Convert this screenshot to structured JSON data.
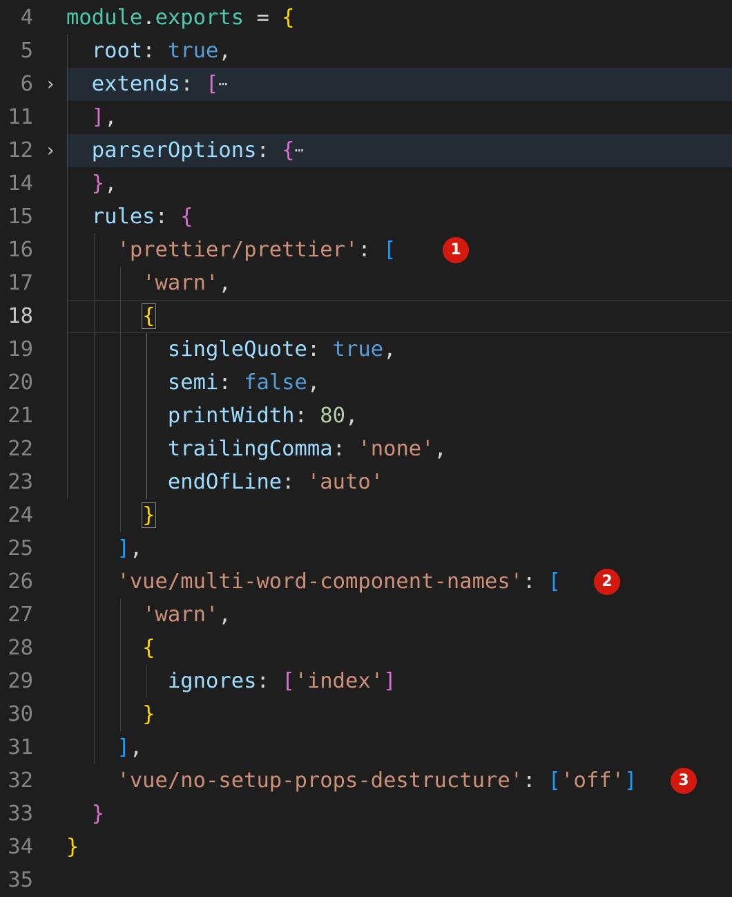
{
  "editor": {
    "language": "javascript",
    "theme": {
      "background": "#1e1e1e",
      "line_highlight": "#232b35",
      "badge_color": "#d4190f"
    },
    "active_line": "18",
    "lines": [
      {
        "num": "4",
        "tokens": [
          {
            "t": "module",
            "c": "pk"
          },
          {
            "t": ".",
            "c": "p"
          },
          {
            "t": "exports",
            "c": "pk"
          },
          {
            "t": " = ",
            "c": "p"
          },
          {
            "t": "{",
            "c": "b1"
          }
        ]
      },
      {
        "num": "5",
        "tokens": [
          {
            "t": "  ",
            "c": "p"
          },
          {
            "t": "root",
            "c": "prop"
          },
          {
            "t": ": ",
            "c": "p"
          },
          {
            "t": "true",
            "c": "kw"
          },
          {
            "t": ",",
            "c": "p"
          }
        ]
      },
      {
        "num": "6",
        "folded": true,
        "highlight": true,
        "tokens": [
          {
            "t": "  ",
            "c": "p"
          },
          {
            "t": "extends",
            "c": "prop"
          },
          {
            "t": ": ",
            "c": "p"
          },
          {
            "t": "[",
            "c": "b2"
          },
          {
            "t": "⋯",
            "c": "ell"
          }
        ]
      },
      {
        "num": "11",
        "tokens": [
          {
            "t": "  ",
            "c": "p"
          },
          {
            "t": "]",
            "c": "b2"
          },
          {
            "t": ",",
            "c": "p"
          }
        ]
      },
      {
        "num": "12",
        "folded": true,
        "highlight": true,
        "tokens": [
          {
            "t": "  ",
            "c": "p"
          },
          {
            "t": "parserOptions",
            "c": "prop"
          },
          {
            "t": ": ",
            "c": "p"
          },
          {
            "t": "{",
            "c": "b2"
          },
          {
            "t": "⋯",
            "c": "ell"
          }
        ]
      },
      {
        "num": "14",
        "tokens": [
          {
            "t": "  ",
            "c": "p"
          },
          {
            "t": "}",
            "c": "b2"
          },
          {
            "t": ",",
            "c": "p"
          }
        ]
      },
      {
        "num": "15",
        "tokens": [
          {
            "t": "  ",
            "c": "p"
          },
          {
            "t": "rules",
            "c": "prop"
          },
          {
            "t": ": ",
            "c": "p"
          },
          {
            "t": "{",
            "c": "b2"
          }
        ]
      },
      {
        "num": "16",
        "badge": "1",
        "tokens": [
          {
            "t": "    ",
            "c": "p"
          },
          {
            "t": "'prettier/prettier'",
            "c": "str"
          },
          {
            "t": ": ",
            "c": "p"
          },
          {
            "t": "[",
            "c": "b3"
          }
        ]
      },
      {
        "num": "17",
        "tokens": [
          {
            "t": "      ",
            "c": "p"
          },
          {
            "t": "'warn'",
            "c": "str"
          },
          {
            "t": ",",
            "c": "p"
          }
        ]
      },
      {
        "num": "18",
        "cursor": true,
        "tokens": [
          {
            "t": "      ",
            "c": "p"
          },
          {
            "t": "{",
            "c": "b1 bracket-box"
          }
        ]
      },
      {
        "num": "19",
        "tokens": [
          {
            "t": "        ",
            "c": "p"
          },
          {
            "t": "singleQuote",
            "c": "prop"
          },
          {
            "t": ": ",
            "c": "p"
          },
          {
            "t": "true",
            "c": "kw"
          },
          {
            "t": ",",
            "c": "p"
          }
        ]
      },
      {
        "num": "20",
        "tokens": [
          {
            "t": "        ",
            "c": "p"
          },
          {
            "t": "semi",
            "c": "prop"
          },
          {
            "t": ": ",
            "c": "p"
          },
          {
            "t": "false",
            "c": "kw"
          },
          {
            "t": ",",
            "c": "p"
          }
        ]
      },
      {
        "num": "21",
        "tokens": [
          {
            "t": "        ",
            "c": "p"
          },
          {
            "t": "printWidth",
            "c": "prop"
          },
          {
            "t": ": ",
            "c": "p"
          },
          {
            "t": "80",
            "c": "num"
          },
          {
            "t": ",",
            "c": "p"
          }
        ]
      },
      {
        "num": "22",
        "tokens": [
          {
            "t": "        ",
            "c": "p"
          },
          {
            "t": "trailingComma",
            "c": "prop"
          },
          {
            "t": ": ",
            "c": "p"
          },
          {
            "t": "'none'",
            "c": "str"
          },
          {
            "t": ",",
            "c": "p"
          }
        ]
      },
      {
        "num": "23",
        "tokens": [
          {
            "t": "        ",
            "c": "p"
          },
          {
            "t": "endOfLine",
            "c": "prop"
          },
          {
            "t": ": ",
            "c": "p"
          },
          {
            "t": "'auto'",
            "c": "str"
          }
        ]
      },
      {
        "num": "24",
        "tokens": [
          {
            "t": "      ",
            "c": "p"
          },
          {
            "t": "}",
            "c": "b1 bracket-box"
          }
        ]
      },
      {
        "num": "25",
        "tokens": [
          {
            "t": "    ",
            "c": "p"
          },
          {
            "t": "]",
            "c": "b3"
          },
          {
            "t": ",",
            "c": "p"
          }
        ]
      },
      {
        "num": "26",
        "badge": "2",
        "tokens": [
          {
            "t": "    ",
            "c": "p"
          },
          {
            "t": "'vue/multi-word-component-names'",
            "c": "str"
          },
          {
            "t": ": ",
            "c": "p"
          },
          {
            "t": "[",
            "c": "b3"
          }
        ]
      },
      {
        "num": "27",
        "tokens": [
          {
            "t": "      ",
            "c": "p"
          },
          {
            "t": "'warn'",
            "c": "str"
          },
          {
            "t": ",",
            "c": "p"
          }
        ]
      },
      {
        "num": "28",
        "tokens": [
          {
            "t": "      ",
            "c": "p"
          },
          {
            "t": "{",
            "c": "b1"
          }
        ]
      },
      {
        "num": "29",
        "tokens": [
          {
            "t": "        ",
            "c": "p"
          },
          {
            "t": "ignores",
            "c": "prop"
          },
          {
            "t": ": ",
            "c": "p"
          },
          {
            "t": "[",
            "c": "b2"
          },
          {
            "t": "'index'",
            "c": "str"
          },
          {
            "t": "]",
            "c": "b2"
          }
        ]
      },
      {
        "num": "30",
        "tokens": [
          {
            "t": "      ",
            "c": "p"
          },
          {
            "t": "}",
            "c": "b1"
          }
        ]
      },
      {
        "num": "31",
        "tokens": [
          {
            "t": "    ",
            "c": "p"
          },
          {
            "t": "]",
            "c": "b3"
          },
          {
            "t": ",",
            "c": "p"
          }
        ]
      },
      {
        "num": "32",
        "badge": "3",
        "tokens": [
          {
            "t": "    ",
            "c": "p"
          },
          {
            "t": "'vue/no-setup-props-destructure'",
            "c": "str"
          },
          {
            "t": ": ",
            "c": "p"
          },
          {
            "t": "[",
            "c": "b3"
          },
          {
            "t": "'off'",
            "c": "str"
          },
          {
            "t": "]",
            "c": "b3"
          }
        ]
      },
      {
        "num": "33",
        "tokens": [
          {
            "t": "  ",
            "c": "p"
          },
          {
            "t": "}",
            "c": "b2"
          }
        ]
      },
      {
        "num": "34",
        "tokens": [
          {
            "t": "}",
            "c": "b1"
          }
        ]
      },
      {
        "num": "35",
        "tokens": []
      }
    ]
  }
}
